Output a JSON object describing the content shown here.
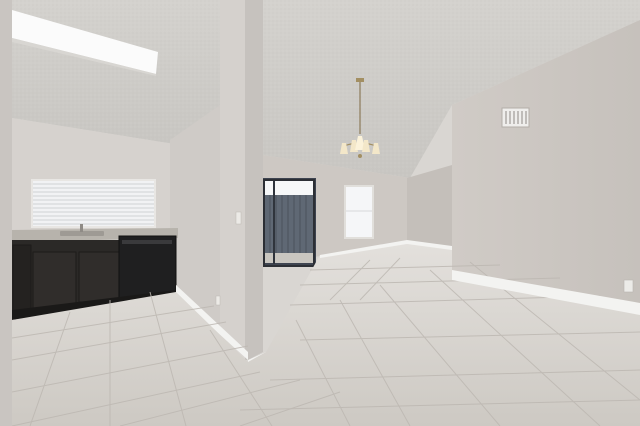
{
  "photo": {
    "subject": "empty-room-interior",
    "features": [
      "ceiling-light",
      "chandelier",
      "kitchenette",
      "sink",
      "dishwasher",
      "window-with-blinds",
      "sliding-glass-door",
      "window",
      "air-vent",
      "tile-floor",
      "baseboard"
    ]
  },
  "colors": {
    "ceiling": "#cfcdc9",
    "wall_light": "#d7d3cf",
    "wall_mid": "#c9c5c1",
    "wall_dark": "#bdb9b5",
    "floor": "#d4d0cb",
    "floor_grout": "#bdb8b2",
    "cabinet": "#2a2826",
    "counter": "#b9b5ae",
    "fence": "#5c6470",
    "window_light": "#f4f5f7",
    "baseboard": "#f2f2f0"
  }
}
